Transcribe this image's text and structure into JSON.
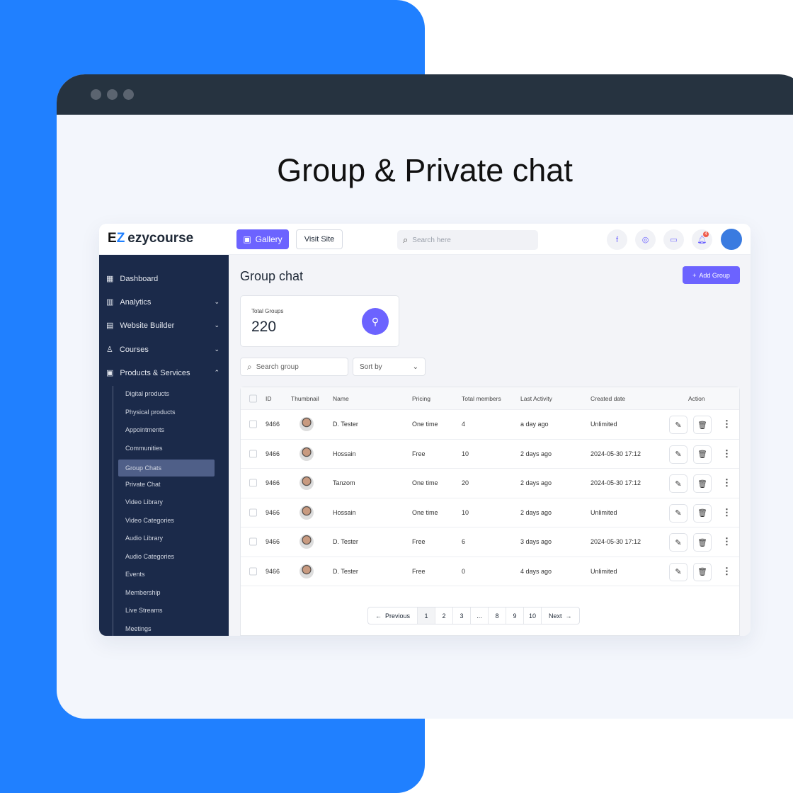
{
  "headline": "Group & Private chat",
  "brand": {
    "name": "ezycourse",
    "mark": "EZ",
    "accent": "#6c63ff",
    "blue": "#2080ff",
    "sidebar_bg": "#1b2a4a"
  },
  "topbar": {
    "gallery": "Gallery",
    "visit_site": "Visit Site",
    "search_placeholder": "Search here",
    "icons": [
      "facebook-icon",
      "messenger-icon",
      "chat-icon",
      "bell-icon"
    ],
    "notification_count": "4"
  },
  "sidebar": {
    "items": [
      {
        "label": "Dashboard",
        "icon": "grid-icon",
        "chevron": false
      },
      {
        "label": "Analytics",
        "icon": "chart-icon",
        "chevron": true
      },
      {
        "label": "Website Builder",
        "icon": "layout-icon",
        "chevron": true
      },
      {
        "label": "Courses",
        "icon": "courses-icon",
        "chevron": true
      },
      {
        "label": "Products & Services",
        "icon": "box-icon",
        "chevron": true
      }
    ],
    "subitems": [
      "Digital products",
      "Physical products",
      "Appointments",
      "Communities",
      "Group Chats",
      "Private Chat",
      "Video Library",
      "Video Categories",
      "Audio Library",
      "Audio Categories",
      "Events",
      "Membership",
      "Live Streams",
      "Meetings"
    ],
    "active": "Group Chats"
  },
  "page": {
    "title": "Group chat",
    "add_button": "Add Group",
    "stat_label": "Total Groups",
    "stat_value": "220",
    "search_placeholder": "Search group",
    "sort_label": "Sort by"
  },
  "table": {
    "columns": [
      "ID",
      "Thumbnail",
      "Name",
      "Pricing",
      "Total members",
      "Last Activity",
      "Created date",
      "Action"
    ],
    "rows": [
      [
        "9466",
        "D. Tester",
        "One time",
        "4",
        "a day ago",
        "Unlimited"
      ],
      [
        "9466",
        "Hossain",
        "Free",
        "10",
        "2 days ago",
        "2024-05-30 17:12"
      ],
      [
        "9466",
        "Tanzom",
        "One time",
        "20",
        "2 days ago",
        "2024-05-30 17:12"
      ],
      [
        "9466",
        "Hossain",
        "One time",
        "10",
        "2 days ago",
        "Unlimited"
      ],
      [
        "9466",
        "D. Tester",
        "Free",
        "6",
        "3 days ago",
        "2024-05-30 17:12"
      ],
      [
        "9466",
        "D. Tester",
        "Free",
        "0",
        "4 days ago",
        "Unlimited"
      ]
    ]
  },
  "pagination": {
    "previous": "Previous",
    "pages": [
      "1",
      "2",
      "3",
      "...",
      "8",
      "9",
      "10"
    ],
    "current": "1",
    "next": "Next"
  }
}
